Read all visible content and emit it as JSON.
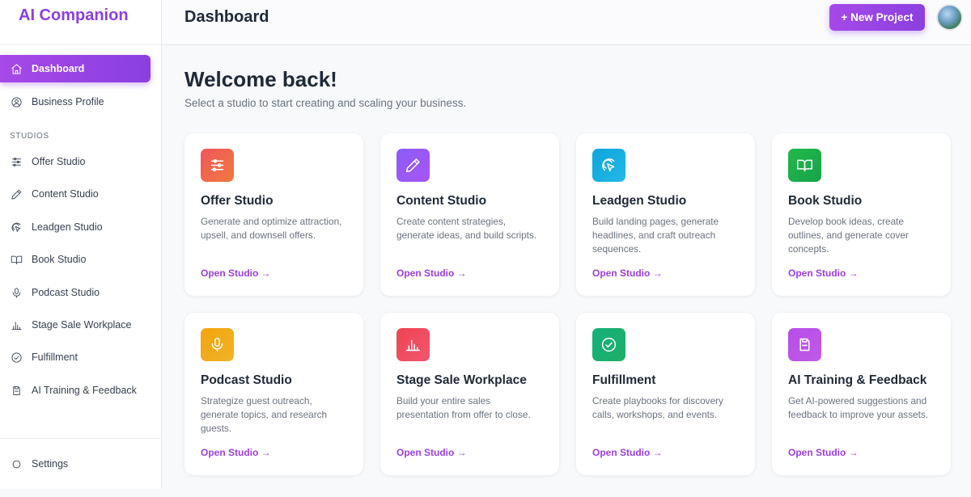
{
  "app": {
    "title": "AI Companion"
  },
  "header": {
    "title": "Dashboard",
    "new_project_label": "+ New Project"
  },
  "sidebar": {
    "primary": [
      {
        "label": "Dashboard",
        "icon": "home-icon",
        "active": true
      },
      {
        "label": "Business Profile",
        "icon": "user-circle-icon"
      }
    ],
    "section_label": "STUDIOS",
    "studios": [
      {
        "label": "Offer Studio",
        "icon": "sliders-icon"
      },
      {
        "label": "Content Studio",
        "icon": "pencil-icon"
      },
      {
        "label": "Leadgen Studio",
        "icon": "pointer-icon"
      },
      {
        "label": "Book Studio",
        "icon": "book-icon"
      },
      {
        "label": "Podcast Studio",
        "icon": "microphone-icon"
      },
      {
        "label": "Stage Sale Workplace",
        "icon": "podium-icon"
      },
      {
        "label": "Fulfillment",
        "icon": "check-circle-icon"
      },
      {
        "label": "AI Training & Feedback",
        "icon": "clipboard-icon"
      }
    ],
    "settings_label": "Settings"
  },
  "main": {
    "welcome": "Welcome back!",
    "subtitle": "Select a studio to start creating and scaling your business.",
    "cards": [
      {
        "title": "Offer Studio",
        "description": "Generate and optimize attraction, upsell, and downsell offers.",
        "link": "Open Studio →",
        "icon": "sliders-icon",
        "color": "#f0565c"
      },
      {
        "title": "Content Studio",
        "description": "Create content strategies, generate ideas, and build scripts.",
        "link": "Open Studio →",
        "icon": "pencil-icon",
        "color": "#8b5cf6"
      },
      {
        "title": "Leadgen Studio",
        "description": "Build landing pages, generate headlines, and craft outreach sequences.",
        "link": "Open Studio →",
        "icon": "pointer-icon",
        "color": "#0ea5d9"
      },
      {
        "title": "Book Studio",
        "description": "Develop book ideas, create outlines, and generate cover concepts.",
        "link": "Open Studio →",
        "icon": "book-icon",
        "color": "#22b84a"
      },
      {
        "title": "Podcast Studio",
        "description": "Strategize guest outreach, generate topics, and research guests.",
        "link": "Open Studio →",
        "icon": "microphone-icon",
        "color": "#f2a40b"
      },
      {
        "title": "Stage Sale Workplace",
        "description": "Build your entire sales presentation from offer to close.",
        "link": "Open Studio →",
        "icon": "podium-icon",
        "color": "#ef4454"
      },
      {
        "title": "Fulfillment",
        "description": "Create playbooks for discovery calls, workshops, and events.",
        "link": "Open Studio →",
        "icon": "check-circle-icon",
        "color": "#16b07a"
      },
      {
        "title": "AI Training & Feedback",
        "description": "Get AI-powered suggestions and feedback to improve your assets.",
        "link": "Open Studio →",
        "icon": "clipboard-icon",
        "color": "#b74ee8"
      }
    ]
  }
}
